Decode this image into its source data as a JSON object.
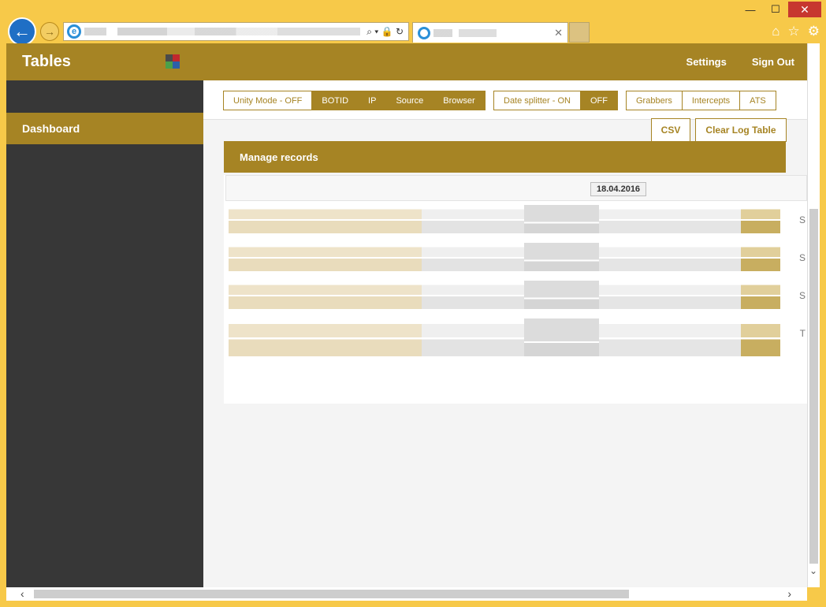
{
  "window": {
    "minimize": "—",
    "maximize": "☐",
    "close": "✕"
  },
  "browser": {
    "back": "←",
    "forward": "→",
    "address_tools": "⌕ ▾ 🔒 ↻",
    "tab_close": "✕",
    "icons": [
      "home-icon",
      "star-icon",
      "gear-icon"
    ]
  },
  "app": {
    "brand": "Tables",
    "nav": {
      "settings": "Settings",
      "signout": "Sign Out"
    },
    "sidebar": {
      "items": [
        {
          "label": "Dashboard"
        }
      ]
    },
    "toolbar": {
      "group1": [
        "Unity Mode - OFF",
        "BOTID",
        "IP",
        "Source",
        "Browser"
      ],
      "group2": [
        "Date splitter - ON",
        "OFF"
      ],
      "group3": [
        "Grabbers",
        "Intercepts",
        "ATS"
      ]
    },
    "actions": {
      "csv": "CSV",
      "clear": "Clear Log Table"
    },
    "panel": {
      "title": "Manage records",
      "date": "18.04.2016"
    },
    "row_tail": [
      "S",
      "S",
      "S",
      "T"
    ]
  },
  "colors": {
    "accent": "#a68424",
    "sidebar": "#373737",
    "frame": "#f7c949"
  }
}
